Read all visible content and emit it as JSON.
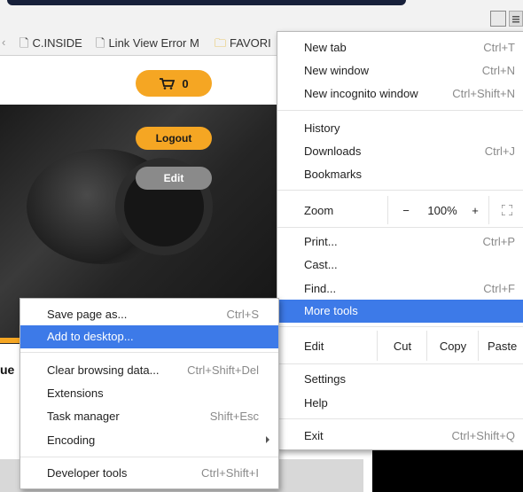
{
  "bookmarks": [
    {
      "label": "C.INSIDE",
      "icon": "page-icon"
    },
    {
      "label": "Link View Error M",
      "icon": "page-icon"
    },
    {
      "label": "FAVORI",
      "icon": "folder-icon"
    }
  ],
  "page": {
    "cart_count": "0",
    "logout_label": "Logout",
    "edit_label": "Edit",
    "fragment_text": "ue"
  },
  "main_menu": {
    "new_tab": {
      "label": "New tab",
      "shortcut": "Ctrl+T"
    },
    "new_window": {
      "label": "New window",
      "shortcut": "Ctrl+N"
    },
    "incognito": {
      "label": "New incognito window",
      "shortcut": "Ctrl+Shift+N"
    },
    "history": {
      "label": "History"
    },
    "downloads": {
      "label": "Downloads",
      "shortcut": "Ctrl+J"
    },
    "bookmarks": {
      "label": "Bookmarks"
    },
    "zoom": {
      "label": "Zoom",
      "minus": "−",
      "value": "100%",
      "plus": "+"
    },
    "print": {
      "label": "Print...",
      "shortcut": "Ctrl+P"
    },
    "cast": {
      "label": "Cast..."
    },
    "find": {
      "label": "Find...",
      "shortcut": "Ctrl+F"
    },
    "more_tools": {
      "label": "More tools"
    },
    "edit": {
      "label": "Edit",
      "cut": "Cut",
      "copy": "Copy",
      "paste": "Paste"
    },
    "settings": {
      "label": "Settings"
    },
    "help": {
      "label": "Help"
    },
    "exit": {
      "label": "Exit",
      "shortcut": "Ctrl+Shift+Q"
    }
  },
  "more_tools_menu": {
    "save_page": {
      "label": "Save page as...",
      "shortcut": "Ctrl+S"
    },
    "add_desktop": {
      "label": "Add to desktop..."
    },
    "clear_data": {
      "label": "Clear browsing data...",
      "shortcut": "Ctrl+Shift+Del"
    },
    "extensions": {
      "label": "Extensions"
    },
    "task_manager": {
      "label": "Task manager",
      "shortcut": "Shift+Esc"
    },
    "encoding": {
      "label": "Encoding"
    },
    "dev_tools": {
      "label": "Developer tools",
      "shortcut": "Ctrl+Shift+I"
    }
  },
  "colors": {
    "highlight": "#3d7ae8",
    "accent": "#f5a623",
    "edit_button": "#8a8a8a"
  }
}
